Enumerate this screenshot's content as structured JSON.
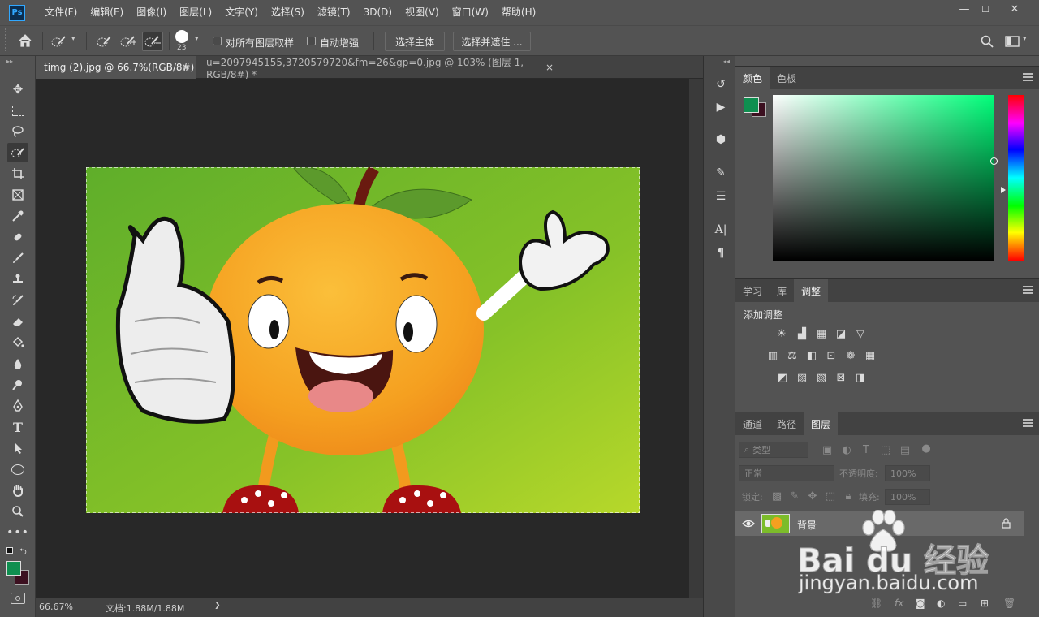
{
  "app": {
    "logo": "Ps"
  },
  "menu": [
    "文件(F)",
    "编辑(E)",
    "图像(I)",
    "图层(L)",
    "文字(Y)",
    "选择(S)",
    "滤镜(T)",
    "3D(D)",
    "视图(V)",
    "窗口(W)",
    "帮助(H)"
  ],
  "window_controls": {
    "minimize": "—",
    "maximize": "☐",
    "close": "✕"
  },
  "options": {
    "brush_size": "23",
    "sample_all_layers": "对所有图层取样",
    "auto_enhance": "自动增强",
    "select_subject": "选择主体",
    "select_and_mask": "选择并遮住 ..."
  },
  "tabs": [
    {
      "title": "timg (2).jpg @ 66.7%(RGB/8#)",
      "close": "×"
    },
    {
      "title": "u=2097945155,3720579720&fm=26&gp=0.jpg @ 103% (图层 1, RGB/8#) *",
      "close": "×"
    }
  ],
  "status": {
    "zoom": "66.67%",
    "doc": "文档:1.88M/1.88M",
    "arrow": "❯"
  },
  "color_panel": {
    "tabs": [
      "颜色",
      "色板"
    ],
    "foreground": "#0f8f50",
    "background": "#3c1020",
    "hue_color": "#00ff7a"
  },
  "adjust_panel": {
    "tabs": [
      "学习",
      "库",
      "调整"
    ],
    "title": "添加调整"
  },
  "layers_panel": {
    "tabs": [
      "通道",
      "路径",
      "图层"
    ],
    "filter_placeholder": "类型",
    "blend_mode": "正常",
    "opacity_label": "不透明度:",
    "opacity_value": "100%",
    "lock_label": "锁定:",
    "fill_label": "填充:",
    "fill_value": "100%",
    "layers": [
      {
        "name": "背景",
        "visible": true,
        "locked": true
      }
    ],
    "footer_fx": "fx"
  },
  "watermark": {
    "brand": "Bai du 经验",
    "url": "jingyan.baidu.com"
  }
}
